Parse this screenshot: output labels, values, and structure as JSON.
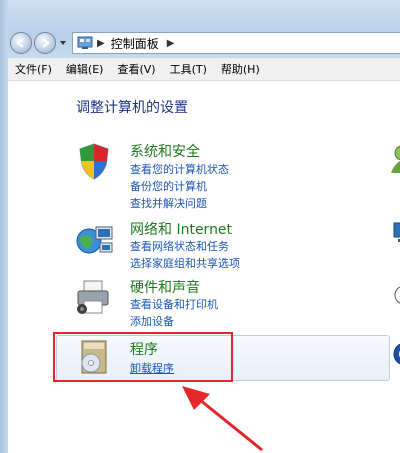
{
  "address": {
    "crumb": "控制面板"
  },
  "menu": [
    {
      "label": "文件(F)"
    },
    {
      "label": "编辑(E)"
    },
    {
      "label": "查看(V)"
    },
    {
      "label": "工具(T)"
    },
    {
      "label": "帮助(H)"
    }
  ],
  "content": {
    "heading": "调整计算机的设置",
    "categories": [
      {
        "title": "系统和安全",
        "links": [
          "查看您的计算机状态",
          "备份您的计算机",
          "查找并解决问题"
        ]
      },
      {
        "title": "网络和 Internet",
        "links": [
          "查看网络状态和任务",
          "选择家庭组和共享选项"
        ]
      },
      {
        "title": "硬件和声音",
        "links": [
          "查看设备和打印机",
          "添加设备"
        ]
      },
      {
        "title": "程序",
        "links": [
          "卸载程序"
        ]
      }
    ]
  },
  "colors": {
    "category_title": "#1e7a1e",
    "link": "#1a56b8",
    "heading": "#1e3287",
    "annotation": "#e5262a"
  },
  "icons": {
    "system_security": "shield-icon",
    "network": "network-globe-icon",
    "hardware": "printer-icon",
    "programs": "programs-disc-icon"
  }
}
